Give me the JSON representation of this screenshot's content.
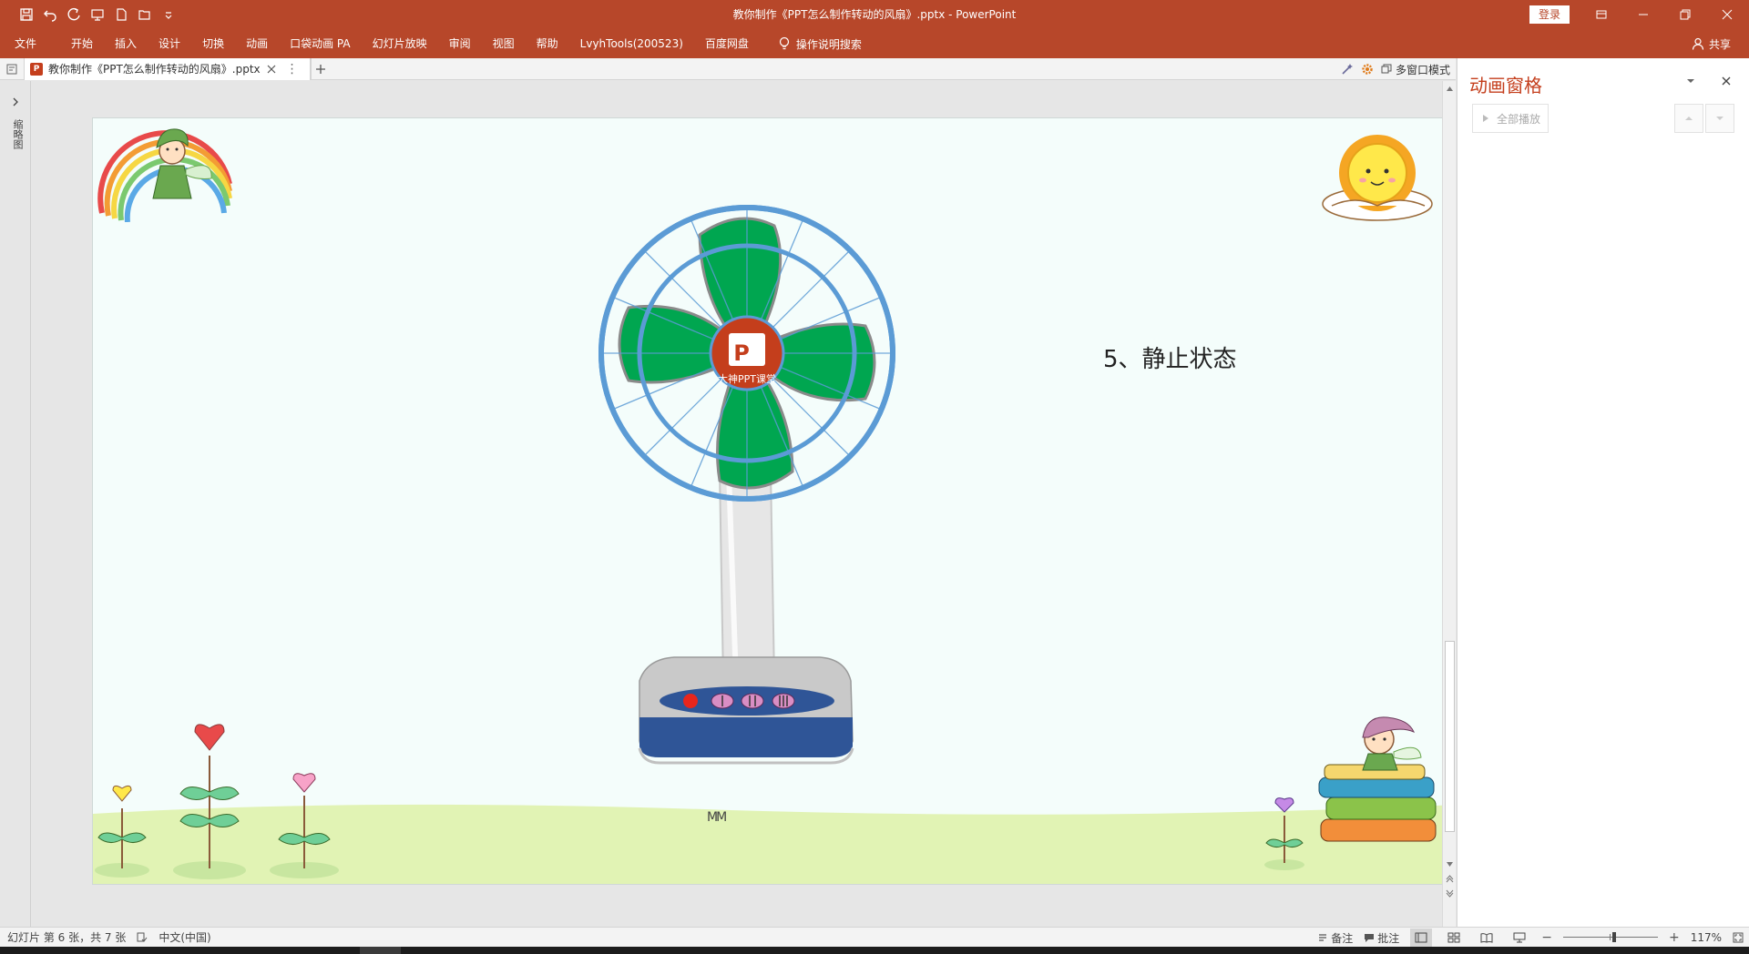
{
  "window": {
    "title": "教你制作《PPT怎么制作转动的风扇》.pptx  -  PowerPoint",
    "login_label": "登录"
  },
  "ribbon_tabs": [
    "文件",
    "开始",
    "插入",
    "设计",
    "切换",
    "动画",
    "口袋动画 PA",
    "幻灯片放映",
    "审阅",
    "视图",
    "帮助",
    "LvyhTools(200523)",
    "百度网盘"
  ],
  "tell_me": "操作说明搜索",
  "share_label": "共享",
  "document_tab": {
    "label": "教你制作《PPT怎么制作转动的风扇》.pptx",
    "icon_letter": "P"
  },
  "multi_window_label": "多窗口模式",
  "thumbnail_pane_label": "缩略图",
  "slide": {
    "text": "5、静止状态",
    "fan_logo_letter": "P",
    "fan_logo_caption": "大神PPT课堂",
    "signature": "MM"
  },
  "animation_pane": {
    "title": "动画窗格",
    "play_all_label": "全部播放"
  },
  "status": {
    "slide_info": "幻灯片 第 6 张，共 7 张",
    "language": "中文(中国)",
    "notes_label": "备注",
    "comments_label": "批注",
    "zoom": "117%",
    "zoom_level": 0.54
  },
  "colors": {
    "brand": "#b7472a",
    "fan_blade": "#00a650",
    "fan_ring": "#5b9bd5",
    "fan_base": "#2f5597"
  }
}
